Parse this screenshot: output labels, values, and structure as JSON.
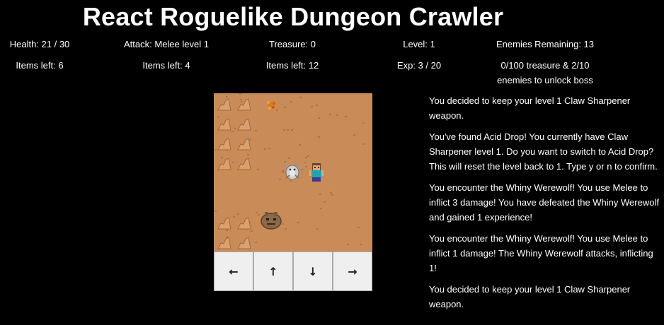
{
  "title": "React Roguelike Dungeon Crawler",
  "stats_row1": {
    "health": "Health: 21 / 30",
    "attack": "Attack: Melee level 1",
    "treasure": "Treasure: 0",
    "level": "Level: 1",
    "enemies": "Enemies Remaining: 13"
  },
  "stats_row2": {
    "items_a": "Items left: 6",
    "items_b": "Items left: 4",
    "items_c": "Items left: 12",
    "exp": "Exp: 3 / 20",
    "boss_line1": "0/100 treasure & 2/10",
    "boss_line2": "enemies to unlock boss"
  },
  "controls": {
    "left": "←",
    "up": "↑",
    "down": "↓",
    "right": "→"
  },
  "log": [
    "You decided to keep your level 1 Claw Sharpener weapon.",
    "You've found Acid Drop! You currently have Claw Sharpener level 1. Do you want to switch to Acid Drop? This will reset the level back to 1. Type y or n to confirm.",
    "You encounter the Whiny Werewolf! You use Melee to inflict 3 damage! You have defeated the Whiny Werewolf and gained 1 experience!",
    "You encounter the Whiny Werewolf! You use Melee to inflict 1 damage! The Whiny Werewolf attacks, inflicting 1!",
    "You decided to keep your level 1 Claw Sharpener weapon."
  ],
  "colors": {
    "background": "#000000",
    "dirt": "#c98b58",
    "wall": "#d9a170"
  },
  "icons": {
    "wall": "wall-tile-icon",
    "treasure": "treasure-icon",
    "enemy": "gargoyle-enemy-icon",
    "player": "player-icon",
    "creature": "rock-creature-icon"
  }
}
